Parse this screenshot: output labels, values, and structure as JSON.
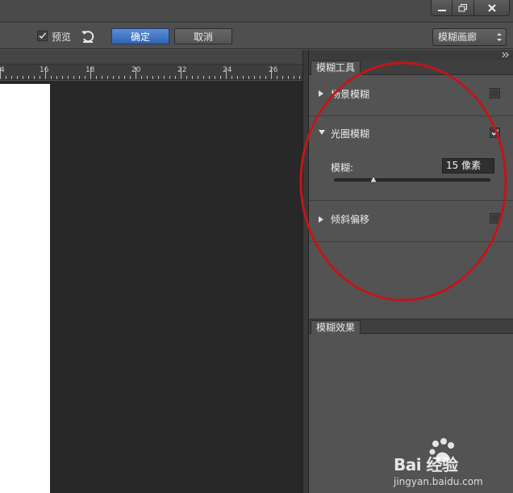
{
  "window": {
    "controls": [
      "minimize-icon",
      "maximize-icon",
      "close-icon"
    ]
  },
  "options_bar": {
    "preview_label": "预览",
    "preview_checked": true,
    "ok_label": "确定",
    "cancel_label": "取消",
    "gallery_select": "模糊画廊"
  },
  "ruler": {
    "labels": [
      "4",
      "16",
      "18",
      "20",
      "22",
      "24",
      "26"
    ]
  },
  "panel": {
    "tools_tab": "模糊工具",
    "sections": [
      {
        "label": "场景模糊",
        "expanded": false,
        "checked": false
      },
      {
        "label": "光圈模糊",
        "expanded": true,
        "checked": true
      },
      {
        "label": "倾斜偏移",
        "expanded": false,
        "checked": false
      }
    ],
    "blur_label": "模糊:",
    "blur_value": "15 像素",
    "blur_slider_fraction": 0.25,
    "effects_tab": "模糊效果"
  },
  "annotation_color": "#c0161a",
  "accent_color": "#3a6fc4",
  "watermark": {
    "brand": "Bai  经验",
    "url": "jingyan.baidu.com"
  }
}
